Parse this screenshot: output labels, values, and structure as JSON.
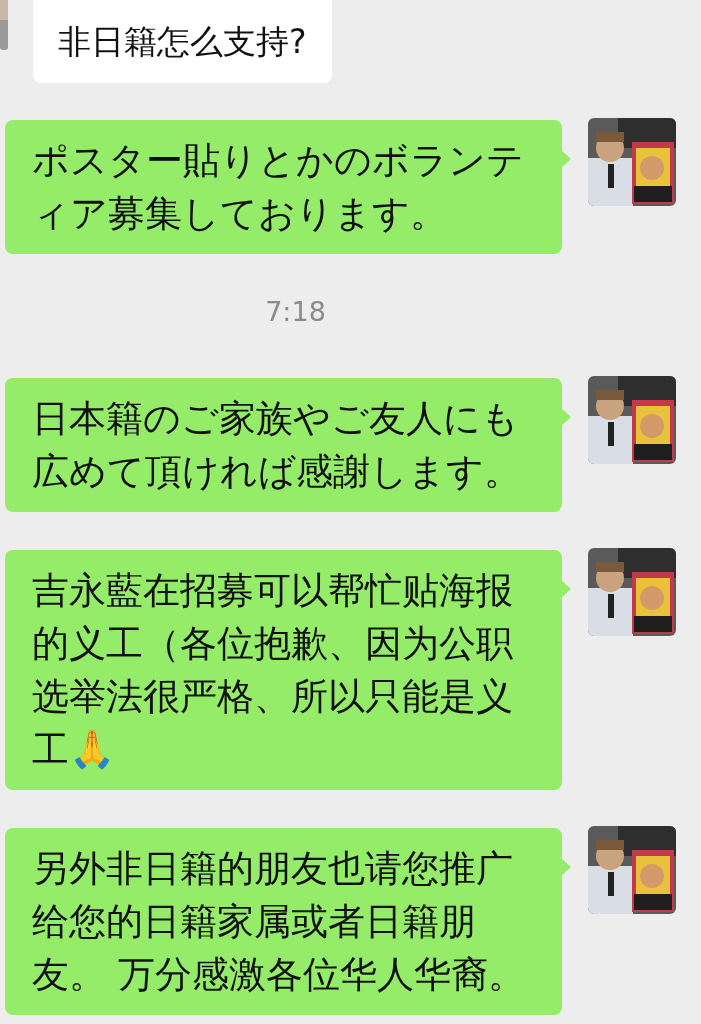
{
  "messages": [
    {
      "kind": "received",
      "lines": [
        "非日籍怎么支持?"
      ]
    },
    {
      "kind": "sent",
      "lines": [
        "ポスター貼りとかのボランテ",
        "ィア募集しております。"
      ]
    },
    {
      "kind": "time",
      "text": "7:18"
    },
    {
      "kind": "sent",
      "lines": [
        "日本籍のご家族やご友人にも",
        "広めて頂ければ感謝します。"
      ]
    },
    {
      "kind": "sent",
      "lines": [
        "吉永藍在招募可以帮忙贴海报",
        "的义工（各位抱歉、因为公职",
        "选举法很严格、所以只能是义",
        "工🙏"
      ]
    },
    {
      "kind": "sent",
      "lines": [
        "另外非日籍的朋友也请您推广",
        "给您的日籍家属或者日籍朋",
        "友。 万分感激各位华人华裔。"
      ]
    }
  ]
}
